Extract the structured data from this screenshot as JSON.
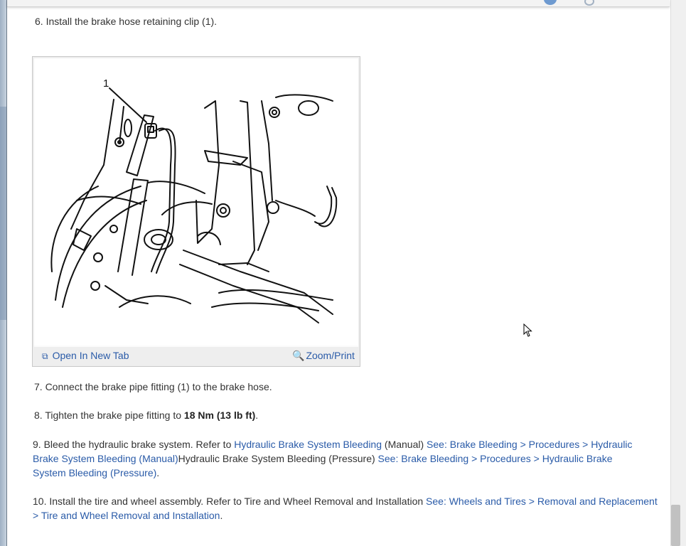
{
  "steps": {
    "step6": "6. Install the brake hose retaining clip (1).",
    "step7": "7. Connect the brake pipe fitting (1) to the brake hose.",
    "step8": {
      "text": "8. Tighten the brake pipe fitting to ",
      "torque": "18 Nm (13 lb ft)",
      "end": "."
    },
    "step9": {
      "text": "9. Bleed the hydraulic brake system. Refer to ",
      "link1": "Hydraulic Brake System Bleeding",
      "mid1": " (Manual) ",
      "link2": "See: Brake Bleeding > Procedures > Hydraulic Brake System Bleeding (Manual)",
      "mid2": "Hydraulic Brake System Bleeding (Pressure) ",
      "link3": "See: Brake Bleeding > Procedures > Hydraulic Brake System Bleeding (Pressure)",
      "end": "."
    },
    "step10": {
      "text": "10. Install the tire and wheel assembly. Refer to Tire and Wheel Removal and Installation ",
      "link": "See: Wheels and Tires > Removal and Replacement > Tire and Wheel Removal and Installation",
      "end": "."
    }
  },
  "figure": {
    "callout": "1",
    "open_tab_label": "Open In New Tab",
    "open_tab_icon": "open-in-new-tab-icon",
    "zoom_label": "Zoom/Print",
    "zoom_icon": "magnifier-icon"
  },
  "colors": {
    "link": "#2a5ba8",
    "body_text": "#333333",
    "page_background": "#ffffff"
  }
}
